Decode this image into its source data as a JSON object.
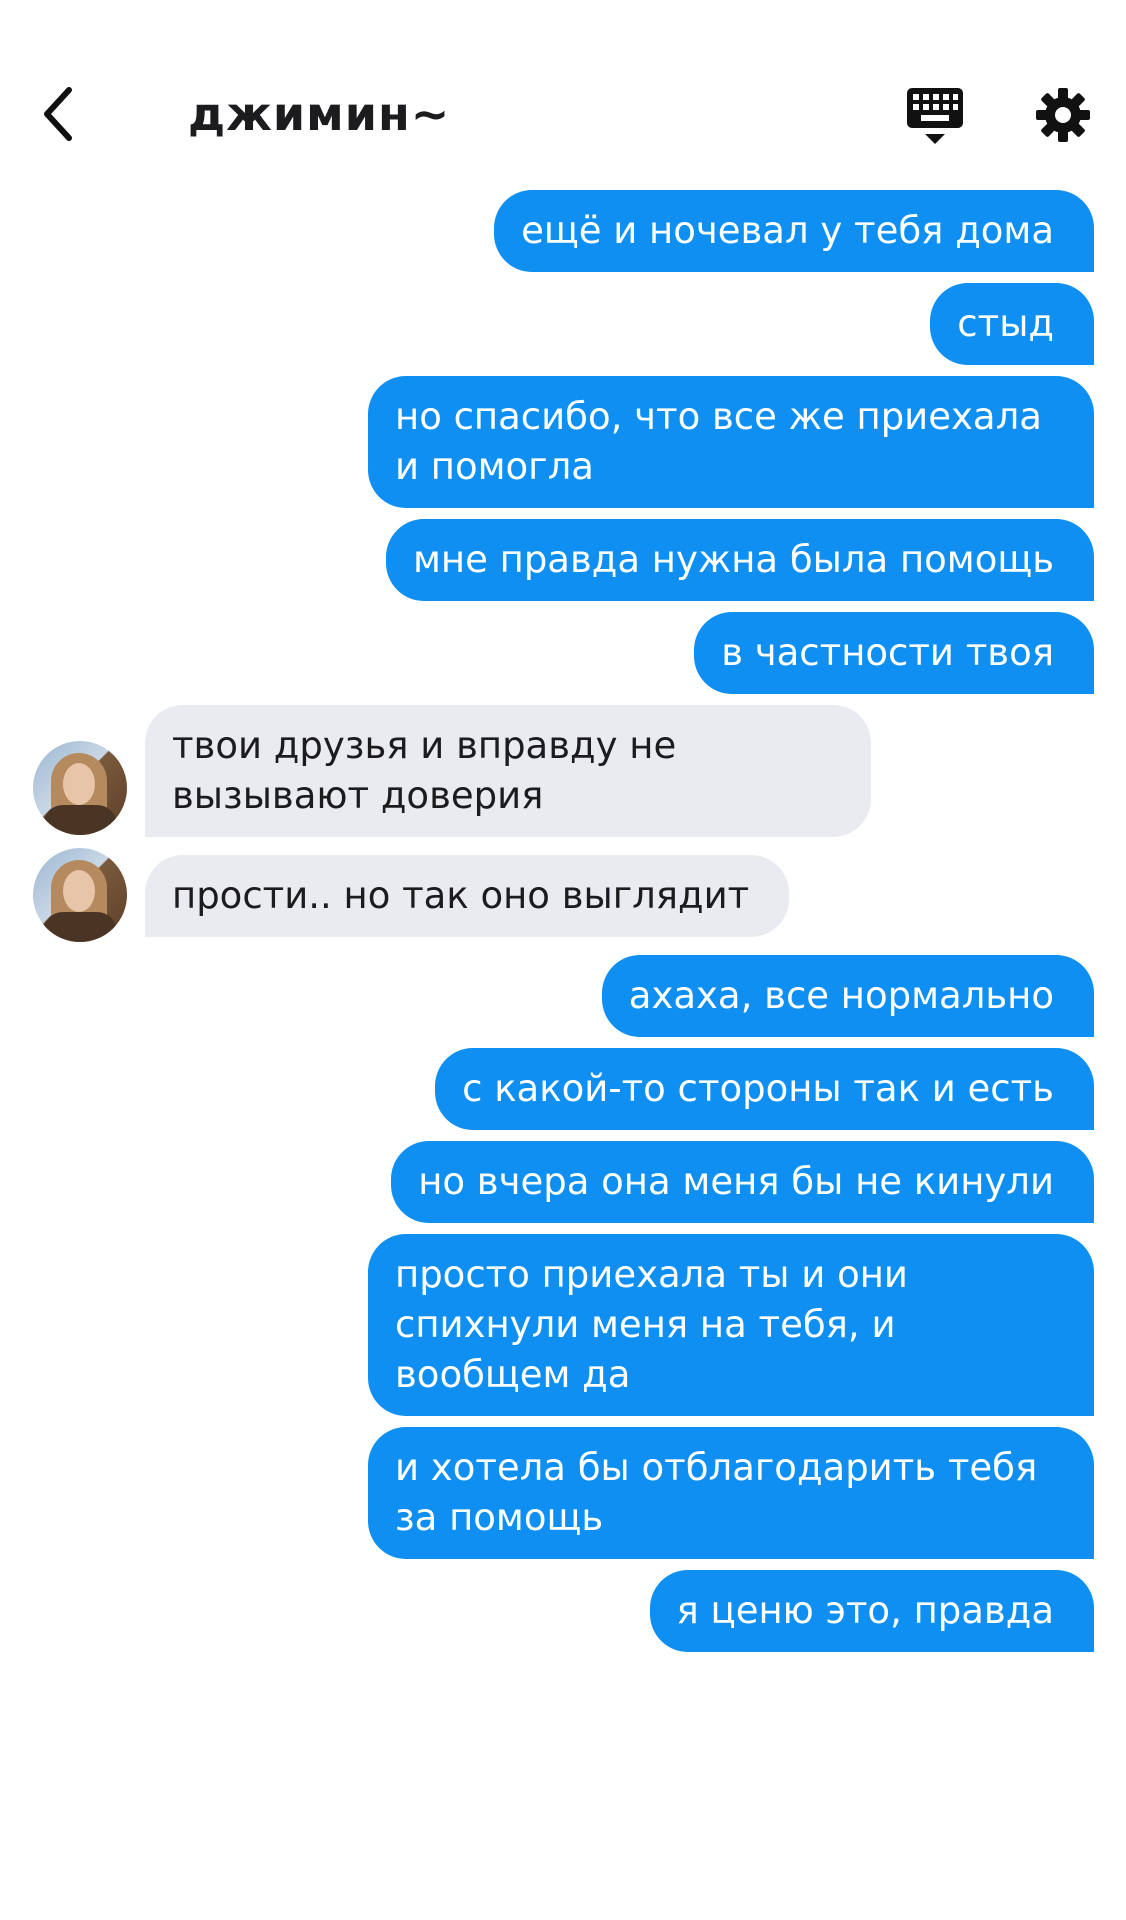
{
  "header": {
    "title": "джимин~"
  },
  "messages": [
    {
      "dir": "out",
      "text": "ещё и ночевал у тебя дома"
    },
    {
      "dir": "out",
      "text": "стыд"
    },
    {
      "dir": "out",
      "text": "но спасибо, что все же приехала и помогла"
    },
    {
      "dir": "out",
      "text": "мне правда нужна была помощь"
    },
    {
      "dir": "out",
      "text": "в частности твоя"
    },
    {
      "dir": "in",
      "text": "твои друзья и вправду не вызывают доверия"
    },
    {
      "dir": "in",
      "text": "прости.. но так оно выглядит"
    },
    {
      "dir": "out",
      "text": "ахаха, все нормально"
    },
    {
      "dir": "out",
      "text": "с какой-то стороны так и есть"
    },
    {
      "dir": "out",
      "text": "но вчера она меня бы не кинули"
    },
    {
      "dir": "out",
      "text": "просто приехала ты и они спихнули меня на тебя, и вообщем да"
    },
    {
      "dir": "out",
      "text": "и хотела бы отблагодарить тебя за помощь"
    },
    {
      "dir": "out",
      "text": "я ценю это, правда"
    }
  ],
  "colors": {
    "outgoing_bubble": "#0f8ff2",
    "incoming_bubble": "#e9ebf1",
    "outgoing_text": "#ffffff",
    "incoming_text": "#1c1c1e"
  },
  "icons": {
    "back": "chevron-left-icon",
    "keyboard": "keyboard-icon",
    "settings": "gear-icon"
  }
}
